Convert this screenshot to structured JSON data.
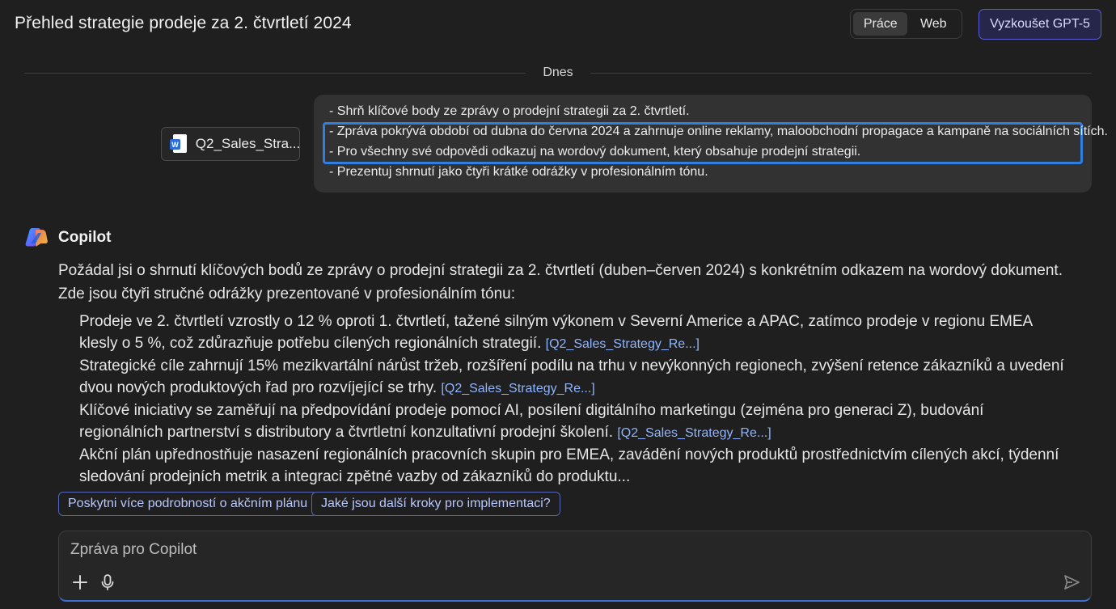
{
  "header": {
    "title": "Přehled strategie prodeje za 2. čtvrtletí 2024",
    "mode_work": "Práce",
    "mode_web": "Web",
    "try_button": "Vyzkoušet GPT-5"
  },
  "chat": {
    "date_divider": "Dnes",
    "attachment": {
      "name": "Q2_Sales_Stra...",
      "icon": "word-document-icon"
    },
    "user_message": [
      "- Shrň klíčové body ze zprávy o prodejní strategii za 2. čtvrtletí.",
      "- Zpráva pokrývá období od dubna do června 2024 a zahrnuje online reklamy, maloobchodní propagace a kampaně na sociálních sítích.",
      "- Pro všechny své odpovědi odkazuj na wordový dokument, který obsahuje prodejní strategii.",
      "- Prezentuj shrnutí jako čtyři krátké odrážky v profesionálním tónu."
    ],
    "assistant": {
      "name": "Copilot",
      "intro": "Požádal jsi o shrnutí klíčových bodů ze zprávy o prodejní strategii za 2. čtvrtletí (duben–červen 2024) s konkrétním odkazem na wordový dokument. Zde jsou čtyři stručné odrážky prezentované v profesionálním tónu:",
      "bullets": [
        {
          "text": "Prodeje ve 2. čtvrtletí vzrostly o 12 % oproti 1. čtvrtletí, tažené silným výkonem v Severní Americe a APAC, zatímco prodeje v regionu EMEA klesly o 5 %, což zdůrazňuje potřebu cílených regionálních strategií.",
          "cite": "[Q2_Sales_Strategy_Re...]"
        },
        {
          "text": "Strategické cíle zahrnují 15% mezikvartální nárůst tržeb, rozšíření podílu na trhu v nevýkonných regionech, zvýšení retence zákazníků a uvedení dvou nových produktových řad pro rozvíjející se trhy.",
          "cite": "[Q2_Sales_Strategy_Re...]"
        },
        {
          "text": "Klíčové iniciativy se zaměřují na předpovídání prodeje pomocí AI, posílení digitálního marketingu (zejména pro generaci Z), budování regionálních partnerství s distributory a čtvrtletní konzultativní prodejní školení.",
          "cite": "[Q2_Sales_Strategy_Re...]"
        },
        {
          "text": "Akční plán upřednostňuje nasazení regionálních pracovních skupin pro EMEA, zavádění nových produktů prostřednictvím cílených akcí, týdenní sledování prodejních metrik a integraci zpětné vazby od zákazníků do produktu...",
          "cite": ""
        }
      ]
    },
    "suggestions": [
      "Poskytni více podrobností o akčním plánu",
      "Jaké jsou další kroky pro implementaci?"
    ]
  },
  "composer": {
    "placeholder": "Zpráva pro Copilot",
    "icons": [
      "plus-icon",
      "microphone-icon",
      "send-icon"
    ]
  },
  "colors": {
    "background": "#1f1f1f",
    "bubble": "#323232",
    "accent": "#2f7fe0",
    "citation": "#8fb4ff"
  }
}
